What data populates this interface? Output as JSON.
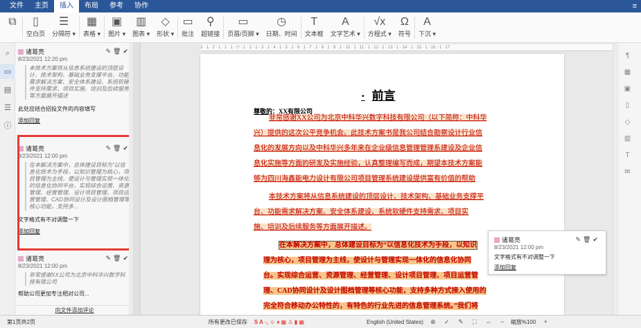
{
  "menu": [
    "文件",
    "主页",
    "插入",
    "布局",
    "参考",
    "协作"
  ],
  "ribbon": {
    "buttons": [
      {
        "icon": "copy-icon",
        "glyph": "⧉",
        "label": ""
      },
      {
        "icon": "blank-page-icon",
        "glyph": "▯",
        "label": "空白页"
      },
      {
        "icon": "page-break-icon",
        "glyph": "☰",
        "label": "分隔符 ▾"
      },
      {
        "icon": "table-icon",
        "glyph": "▦",
        "label": "表格 ▾"
      },
      {
        "icon": "image-icon",
        "glyph": "▣",
        "label": "图片 ▾"
      },
      {
        "icon": "chart-icon",
        "glyph": "▥",
        "label": "图表 ▾"
      },
      {
        "icon": "shape-icon",
        "glyph": "◇",
        "label": "形状 ▾"
      },
      {
        "icon": "comment-icon",
        "glyph": "▭",
        "label": "批注"
      },
      {
        "icon": "link-icon",
        "glyph": "⚲",
        "label": "超链接"
      },
      {
        "icon": "header-footer-icon",
        "glyph": "▭",
        "label": "页眉/页脚 ▾"
      },
      {
        "icon": "date-time-icon",
        "glyph": "◷",
        "label": "日期、时间"
      },
      {
        "icon": "textbox-icon",
        "glyph": "T",
        "label": "文本框"
      },
      {
        "icon": "text-art-icon",
        "glyph": "A",
        "label": "文字艺术 ▾"
      },
      {
        "icon": "equation-icon",
        "glyph": "√x",
        "label": "方程式 ▾"
      },
      {
        "icon": "symbol-icon",
        "glyph": "Ω",
        "label": "符号"
      },
      {
        "icon": "dropcap-icon",
        "glyph": "A",
        "label": "下沉 ▾"
      }
    ]
  },
  "left_panel": {
    "comments": [
      {
        "author": "诸葛亮",
        "date": "8/23/2021 12:20 pm",
        "quote": "本技术方案将从信息系统建设的顶层设计、技术架构、基础业务支撑平台、功能需求解决方案、安全体系建设、系统软硬件支持需求、项目实施、培训及后续服务等方面展开描述",
        "text": "此处应结合招投文件的内容填写",
        "reply": "添加回复"
      },
      {
        "author": "诸葛亮",
        "date": "8/23/2021 12:00 pm",
        "quote": "在本解决方案中，总体建设目标为“以信息化技术为手段，以知识管理为核心，项目管理为主线，使设计与管理实现一体化的信息化协同平台，实现综合运营、资源管理、经营管理、设计项目管理、项目运营管理、CAD协同设计及设计图档管理等核心功能，支持多...",
        "text": "文字格式有不对调整一下",
        "reply": "添加回复"
      },
      {
        "author": "诸葛亮",
        "date": "8/23/2021 12:00 pm",
        "quote": "非常感谢XX公司为北京中科华兴数字科技有限公司",
        "text": "帮助公司更加专注相对公司...",
        "reply": ""
      }
    ],
    "add_all": "向文件添加评论"
  },
  "document": {
    "title": "前言",
    "salutation": "尊敬的：XX有限公司",
    "paragraph1": [
      "非常感谢XX公司为北京中科华兴数字科技有限公司（以下简称：中科华",
      "兴）提供的这次公平竞争机会。此技术方案书是我公司结合勘察设计行业信",
      "息化的发展方向以及中科华兴多年来在企业级信息管理管理系建设及企业信",
      "息化实施等方面的研发及实施经验，认真整理编写而成，期望本技术方案能",
      "够为四川海鑫能电力设计有限公司项目管理系统建设提供富有价值的帮助"
    ],
    "paragraph2": [
      "本技术方案将从信息系统建设的顶层设计、技术架构、基础业务支撑平",
      "台、功能需求解决方案、安全体系建设、系统软硬件支持需求、项目实",
      "施、培训及后续服务等方面展开描述。"
    ],
    "paragraph3": [
      "在本解决方案中，总体建设目标为“以信息化技术为手段，以知识",
      "理为核心，项目管理为主线，使设计与管理实现一体化的信息化协同",
      "台。实现综合运营、资源管理、经营管理、设计项目管理、项目运营管",
      "理、CAD协同设计及设计图档管理等核心功能，支持多种方式接入使用的",
      "完全符合移动办公特性的，有特色的行业先进的信息管理系统。”我们将"
    ],
    "ruler": "3 · 1 · 2 · 1 · 1 · 1 · ▽ · 1 · 2 · 1 · 3 · 1 · 4 · 1 · 5 · 1 · 6 · 1 · 7 · 1 · 8 · 1 · 9 · 1 · 10 · 1 · 11 · 1 · 12 · 1 · 13 · 1 · 14 · 1 · 15 · 1 · 16 · 1 · 17"
  },
  "popup": {
    "author": "诸葛亮",
    "date": "8/23/2021 12:00 pm",
    "text": "文字格式有不对调整一下",
    "reply": "添加回复"
  },
  "status": {
    "page": "第1页共2页",
    "saved": "所有更改已保存",
    "language": "English (United States)",
    "zoom": "缩放%100"
  }
}
